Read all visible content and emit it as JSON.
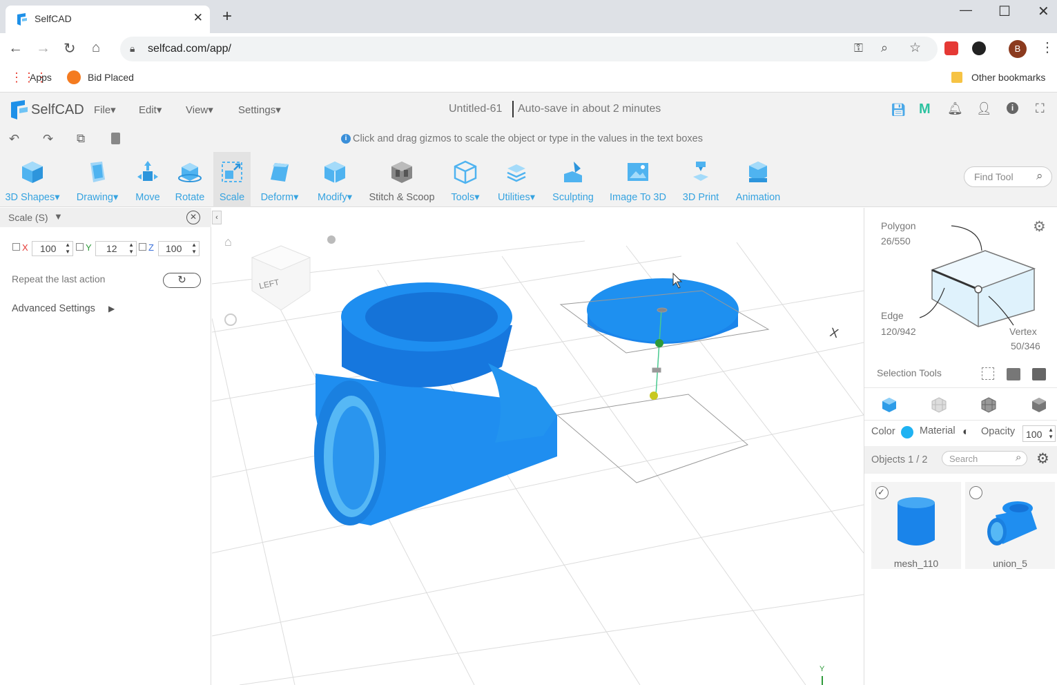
{
  "browser": {
    "tab_title": "SelfCAD",
    "url": "selfcad.com/app/",
    "bookmarks": [
      {
        "label": "Apps",
        "icon": "apps-grid-icon"
      },
      {
        "label": "Bid Placed",
        "icon": "bid-icon"
      }
    ],
    "other_bookmarks": "Other bookmarks",
    "profile_initial": "B"
  },
  "app": {
    "logo": "SelfCAD",
    "menus": [
      "File",
      "Edit",
      "View",
      "Settings"
    ],
    "file_title": "Untitled-61",
    "autosave": "Auto-save in about 2 minutes",
    "hint": "Click and drag gizmos to scale the object or type in the values in the text boxes",
    "find_tool_placeholder": "Find Tool",
    "brand_color": "#1e90e8"
  },
  "tools": [
    {
      "label": "3D Shapes",
      "dropdown": true
    },
    {
      "label": "Drawing",
      "dropdown": true
    },
    {
      "label": "Move"
    },
    {
      "label": "Rotate"
    },
    {
      "label": "Scale",
      "active": true
    },
    {
      "label": "Deform",
      "dropdown": true
    },
    {
      "label": "Modify",
      "dropdown": true
    },
    {
      "label": "Stitch & Scoop"
    },
    {
      "label": "Tools",
      "dropdown": true
    },
    {
      "label": "Utilities",
      "dropdown": true
    },
    {
      "label": "Sculpting"
    },
    {
      "label": "Image To 3D"
    },
    {
      "label": "3D Print"
    },
    {
      "label": "Animation"
    }
  ],
  "scale_panel": {
    "title": "Scale (S)",
    "x_label": "X",
    "x_value": "100",
    "y_label": "Y",
    "y_value": "12",
    "z_label": "Z",
    "z_value": "100",
    "repeat_label": "Repeat the last action",
    "advanced_label": "Advanced Settings"
  },
  "right_panel": {
    "polygon_label": "Polygon",
    "polygon_count": "26/550",
    "edge_label": "Edge",
    "edge_count": "120/942",
    "vertex_label": "Vertex",
    "vertex_count": "50/346",
    "selection_tools": "Selection Tools",
    "color_label": "Color",
    "material_label": "Material",
    "opacity_label": "Opacity",
    "opacity_value": "100",
    "objects_label": "Objects 1 / 2",
    "search_placeholder": "Search",
    "objects": [
      {
        "name": "mesh_110",
        "selected": true
      },
      {
        "name": "union_5",
        "selected": false
      }
    ]
  },
  "viewport": {
    "view_cube_label": "LEFT",
    "axis_x": "X",
    "axis_y": "Y"
  }
}
